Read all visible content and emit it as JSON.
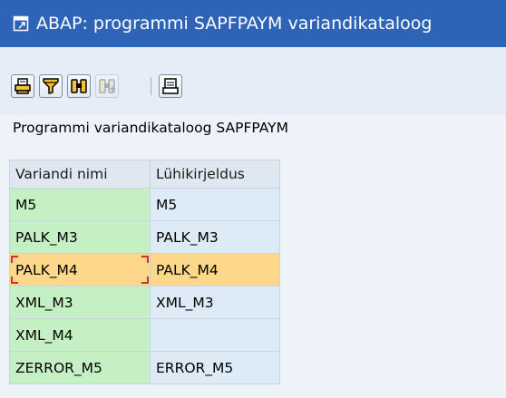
{
  "window": {
    "title": "ABAP: programmi SAPFPAYM variandikataloog",
    "title_icon": "external-window-icon"
  },
  "toolbar": {
    "buttons": [
      {
        "icon": "print-icon",
        "enabled": true
      },
      {
        "icon": "filter-icon",
        "enabled": true
      },
      {
        "icon": "find-icon",
        "enabled": true
      },
      {
        "icon": "find-next-icon",
        "enabled": false
      },
      {
        "icon": "local-file-icon",
        "enabled": true
      }
    ]
  },
  "caption": "Programmi variandikataloog SAPFPAYM",
  "table": {
    "headers": [
      "Variandi nimi",
      "Lühikirjeldus"
    ],
    "rows": [
      {
        "name": "M5",
        "description": "M5"
      },
      {
        "name": "PALK_M3",
        "description": "PALK_M3"
      },
      {
        "name": "PALK_M4",
        "description": "PALK_M4",
        "selected": true
      },
      {
        "name": "XML_M3",
        "description": "XML_M3"
      },
      {
        "name": "XML_M4",
        "description": ""
      },
      {
        "name": "ZERROR_M5",
        "description": "ERROR_M5"
      }
    ]
  },
  "colors": {
    "titlebar": "#2e64b7",
    "key_cell": "#c5f0c4",
    "value_cell": "#ddebf7",
    "selected_row": "#fdd88b",
    "focus_frame": "#d0312d",
    "icon_yellow": "#f1c32e"
  }
}
